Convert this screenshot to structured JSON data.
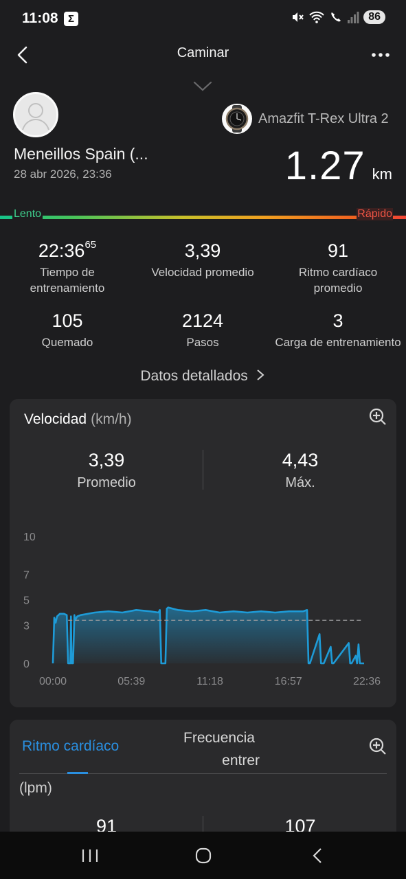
{
  "status_bar": {
    "time": "11:08",
    "app_icon": "Σ",
    "battery": "86",
    "icons": [
      "mute-icon",
      "wifi-icon",
      "wifi-calling-icon",
      "signal-icon"
    ]
  },
  "header": {
    "title": "Caminar",
    "back_icon": "back-arrow-icon",
    "more_icon": "more-dots-icon",
    "collapse_icon": "chevron-down-icon"
  },
  "profile": {
    "name": "Meneillos Spain (...",
    "date": "28 abr 2026, 23:36",
    "device": "Amazfit T-Rex Ultra 2"
  },
  "distance": {
    "value": "1.27",
    "unit": "km"
  },
  "pace_bar": {
    "slow": "Lento",
    "fast": "Rápido"
  },
  "stats": [
    {
      "value": "22:36",
      "sup": "65",
      "label": "Tiempo de entrenamiento"
    },
    {
      "value": "3,39",
      "label": "Velocidad promedio"
    },
    {
      "value": "91",
      "label": "Ritmo cardíaco promedio"
    },
    {
      "value": "105",
      "label": "Quemado"
    },
    {
      "value": "2124",
      "label": "Pasos"
    },
    {
      "value": "3",
      "label": "Carga de entrenamiento"
    }
  ],
  "detailed_link": "Datos detallados",
  "speed_card": {
    "title": "Velocidad",
    "unit": "(km/h)",
    "avg_value": "3,39",
    "avg_label": "Promedio",
    "max_value": "4,43",
    "max_label": "Máx."
  },
  "chart_data": {
    "type": "area",
    "title": "Velocidad",
    "ylabel": "(km/h)",
    "y_ticks": [
      0,
      3,
      5,
      7,
      10
    ],
    "ylim": [
      0,
      10
    ],
    "x_ticks": [
      "00:00",
      "05:39",
      "11:18",
      "16:57",
      "22:36"
    ],
    "x_minutes": [
      0,
      0.1,
      0.2,
      0.3,
      0.5,
      0.8,
      1.0,
      1.1,
      1.25,
      1.3,
      1.35,
      1.45,
      1.55,
      1.6,
      1.75,
      2.0,
      3.0,
      4.0,
      5.0,
      6.0,
      7.0,
      7.6,
      7.7,
      7.8,
      8.1,
      8.2,
      8.3,
      9.0,
      10.0,
      11.0,
      12.0,
      13.0,
      14.0,
      15.0,
      16.0,
      17.0,
      18.0,
      18.3,
      18.4,
      18.5,
      19.2,
      19.3,
      19.4,
      19.5,
      20.0,
      20.1,
      20.2,
      21.3,
      21.4,
      21.5,
      21.8,
      21.9,
      22.0,
      22.1,
      22.15,
      22.3,
      22.4
    ],
    "values": [
      0,
      3.6,
      3.2,
      3.7,
      3.9,
      3.9,
      3.8,
      0,
      0,
      3.7,
      0,
      0,
      3.8,
      3.4,
      3.7,
      3.8,
      4.0,
      4.1,
      4.0,
      4.2,
      4.1,
      4.0,
      4.2,
      0,
      0,
      4.3,
      4.4,
      4.2,
      4.1,
      4.2,
      4.0,
      4.1,
      4.0,
      4.1,
      4.0,
      4.1,
      4.1,
      4.2,
      0,
      0,
      2.3,
      0,
      0,
      0,
      1.3,
      0,
      0,
      1.6,
      0,
      0,
      0.6,
      0,
      1.5,
      0,
      0,
      0,
      0
    ],
    "average": 3.39,
    "series": [
      {
        "name": "Velocidad",
        "color": "#1e9bd7"
      }
    ]
  },
  "hr_card": {
    "tab_active": "Ritmo cardíaco",
    "tab_other_line1": "Frecuencia",
    "tab_other_line2": "entrer",
    "unit": "(lpm)",
    "avg_value": "91",
    "max_value": "107"
  },
  "colors": {
    "background": "#1d1d1f",
    "card": "#2a2a2c",
    "accent": "#2a8fe0",
    "chart_line": "#1e9bd7",
    "slow": "#3fd18e",
    "fast": "#f05545"
  },
  "nav": {
    "recents_icon": "recents-icon",
    "home_icon": "home-icon",
    "back_icon": "nav-back-icon"
  }
}
